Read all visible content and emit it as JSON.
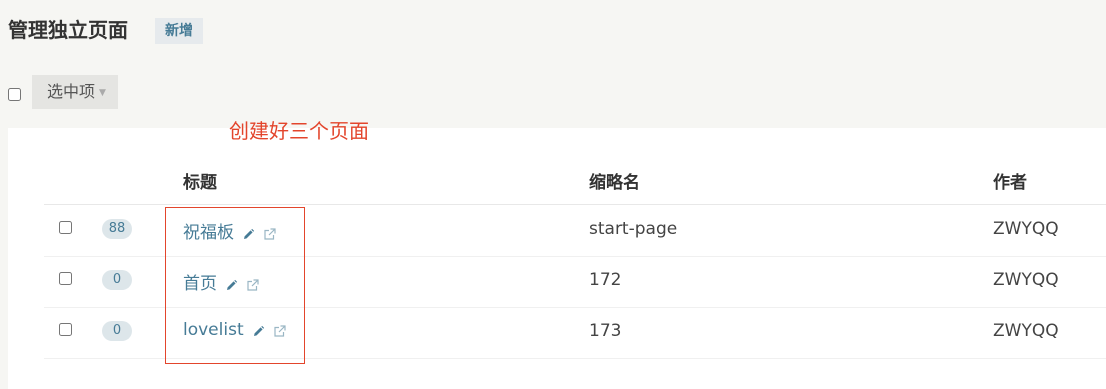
{
  "header": {
    "title": "管理独立页面",
    "add_label": "新增"
  },
  "toolbar": {
    "selected_label": "选中项"
  },
  "annotation": {
    "text": "创建好三个页面",
    "color": "#e3452c"
  },
  "table": {
    "columns": {
      "title": "标题",
      "slug": "缩略名",
      "author": "作者"
    },
    "rows": [
      {
        "count": "88",
        "title": "祝福板",
        "slug": "start-page",
        "author": "ZWYQQ"
      },
      {
        "count": "0",
        "title": "首页",
        "slug": "172",
        "author": "ZWYQQ"
      },
      {
        "count": "0",
        "title": "lovelist",
        "slug": "173",
        "author": "ZWYQQ"
      }
    ]
  },
  "icons": {
    "edit": "pencil-icon",
    "open": "external-link-icon",
    "dropdown": "caret-down-icon"
  },
  "colors": {
    "link": "#467b96",
    "badge_bg": "#dde6ea",
    "page_bg": "#f6f6f3"
  }
}
